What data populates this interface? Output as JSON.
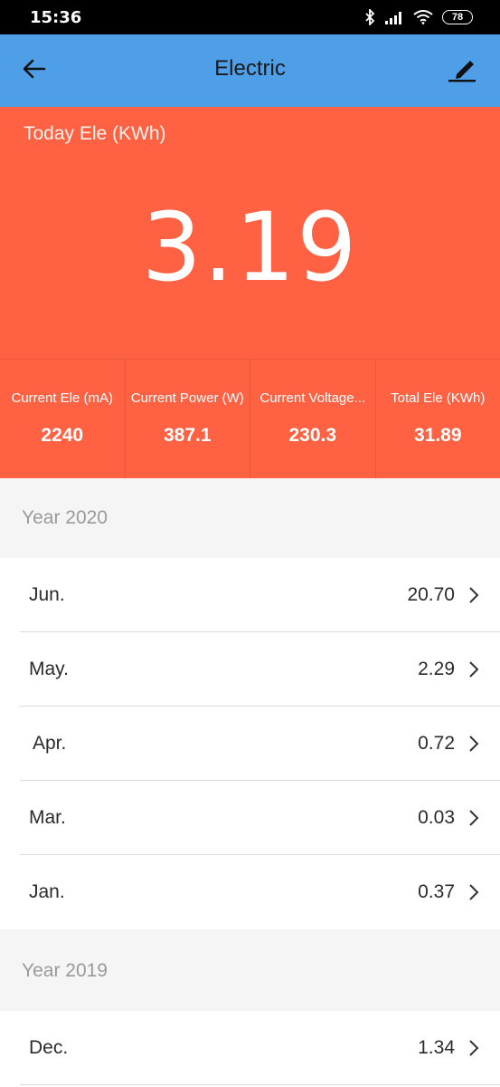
{
  "status_bar": {
    "time": "15:36",
    "battery": "78",
    "icons": [
      "bluetooth-icon",
      "signal-icon",
      "wifi-icon",
      "battery-icon"
    ]
  },
  "header": {
    "title": "Electric",
    "back_icon": "back-arrow-icon",
    "edit_icon": "edit-pen-icon",
    "color": "#4f9ee8"
  },
  "summary": {
    "today_label": "Today Ele (KWh)",
    "today_value": "3.19",
    "color": "#fe6243",
    "stats": [
      {
        "label": "Current Ele (mA)",
        "value": "2240"
      },
      {
        "label": "Current Power (W)",
        "value": "387.1"
      },
      {
        "label": "Current Voltage...",
        "value": "230.3"
      },
      {
        "label": "Total Ele (KWh)",
        "value": "31.89"
      }
    ]
  },
  "sections": [
    {
      "title": "Year 2020",
      "rows": [
        {
          "month": "Jun.",
          "value": "20.70"
        },
        {
          "month": "May.",
          "value": "2.29"
        },
        {
          "month": "Apr.",
          "value": "0.72"
        },
        {
          "month": "Mar.",
          "value": "0.03"
        },
        {
          "month": "Jan.",
          "value": "0.37"
        }
      ]
    },
    {
      "title": "Year 2019",
      "rows": [
        {
          "month": "Dec.",
          "value": "1.34"
        }
      ]
    }
  ]
}
